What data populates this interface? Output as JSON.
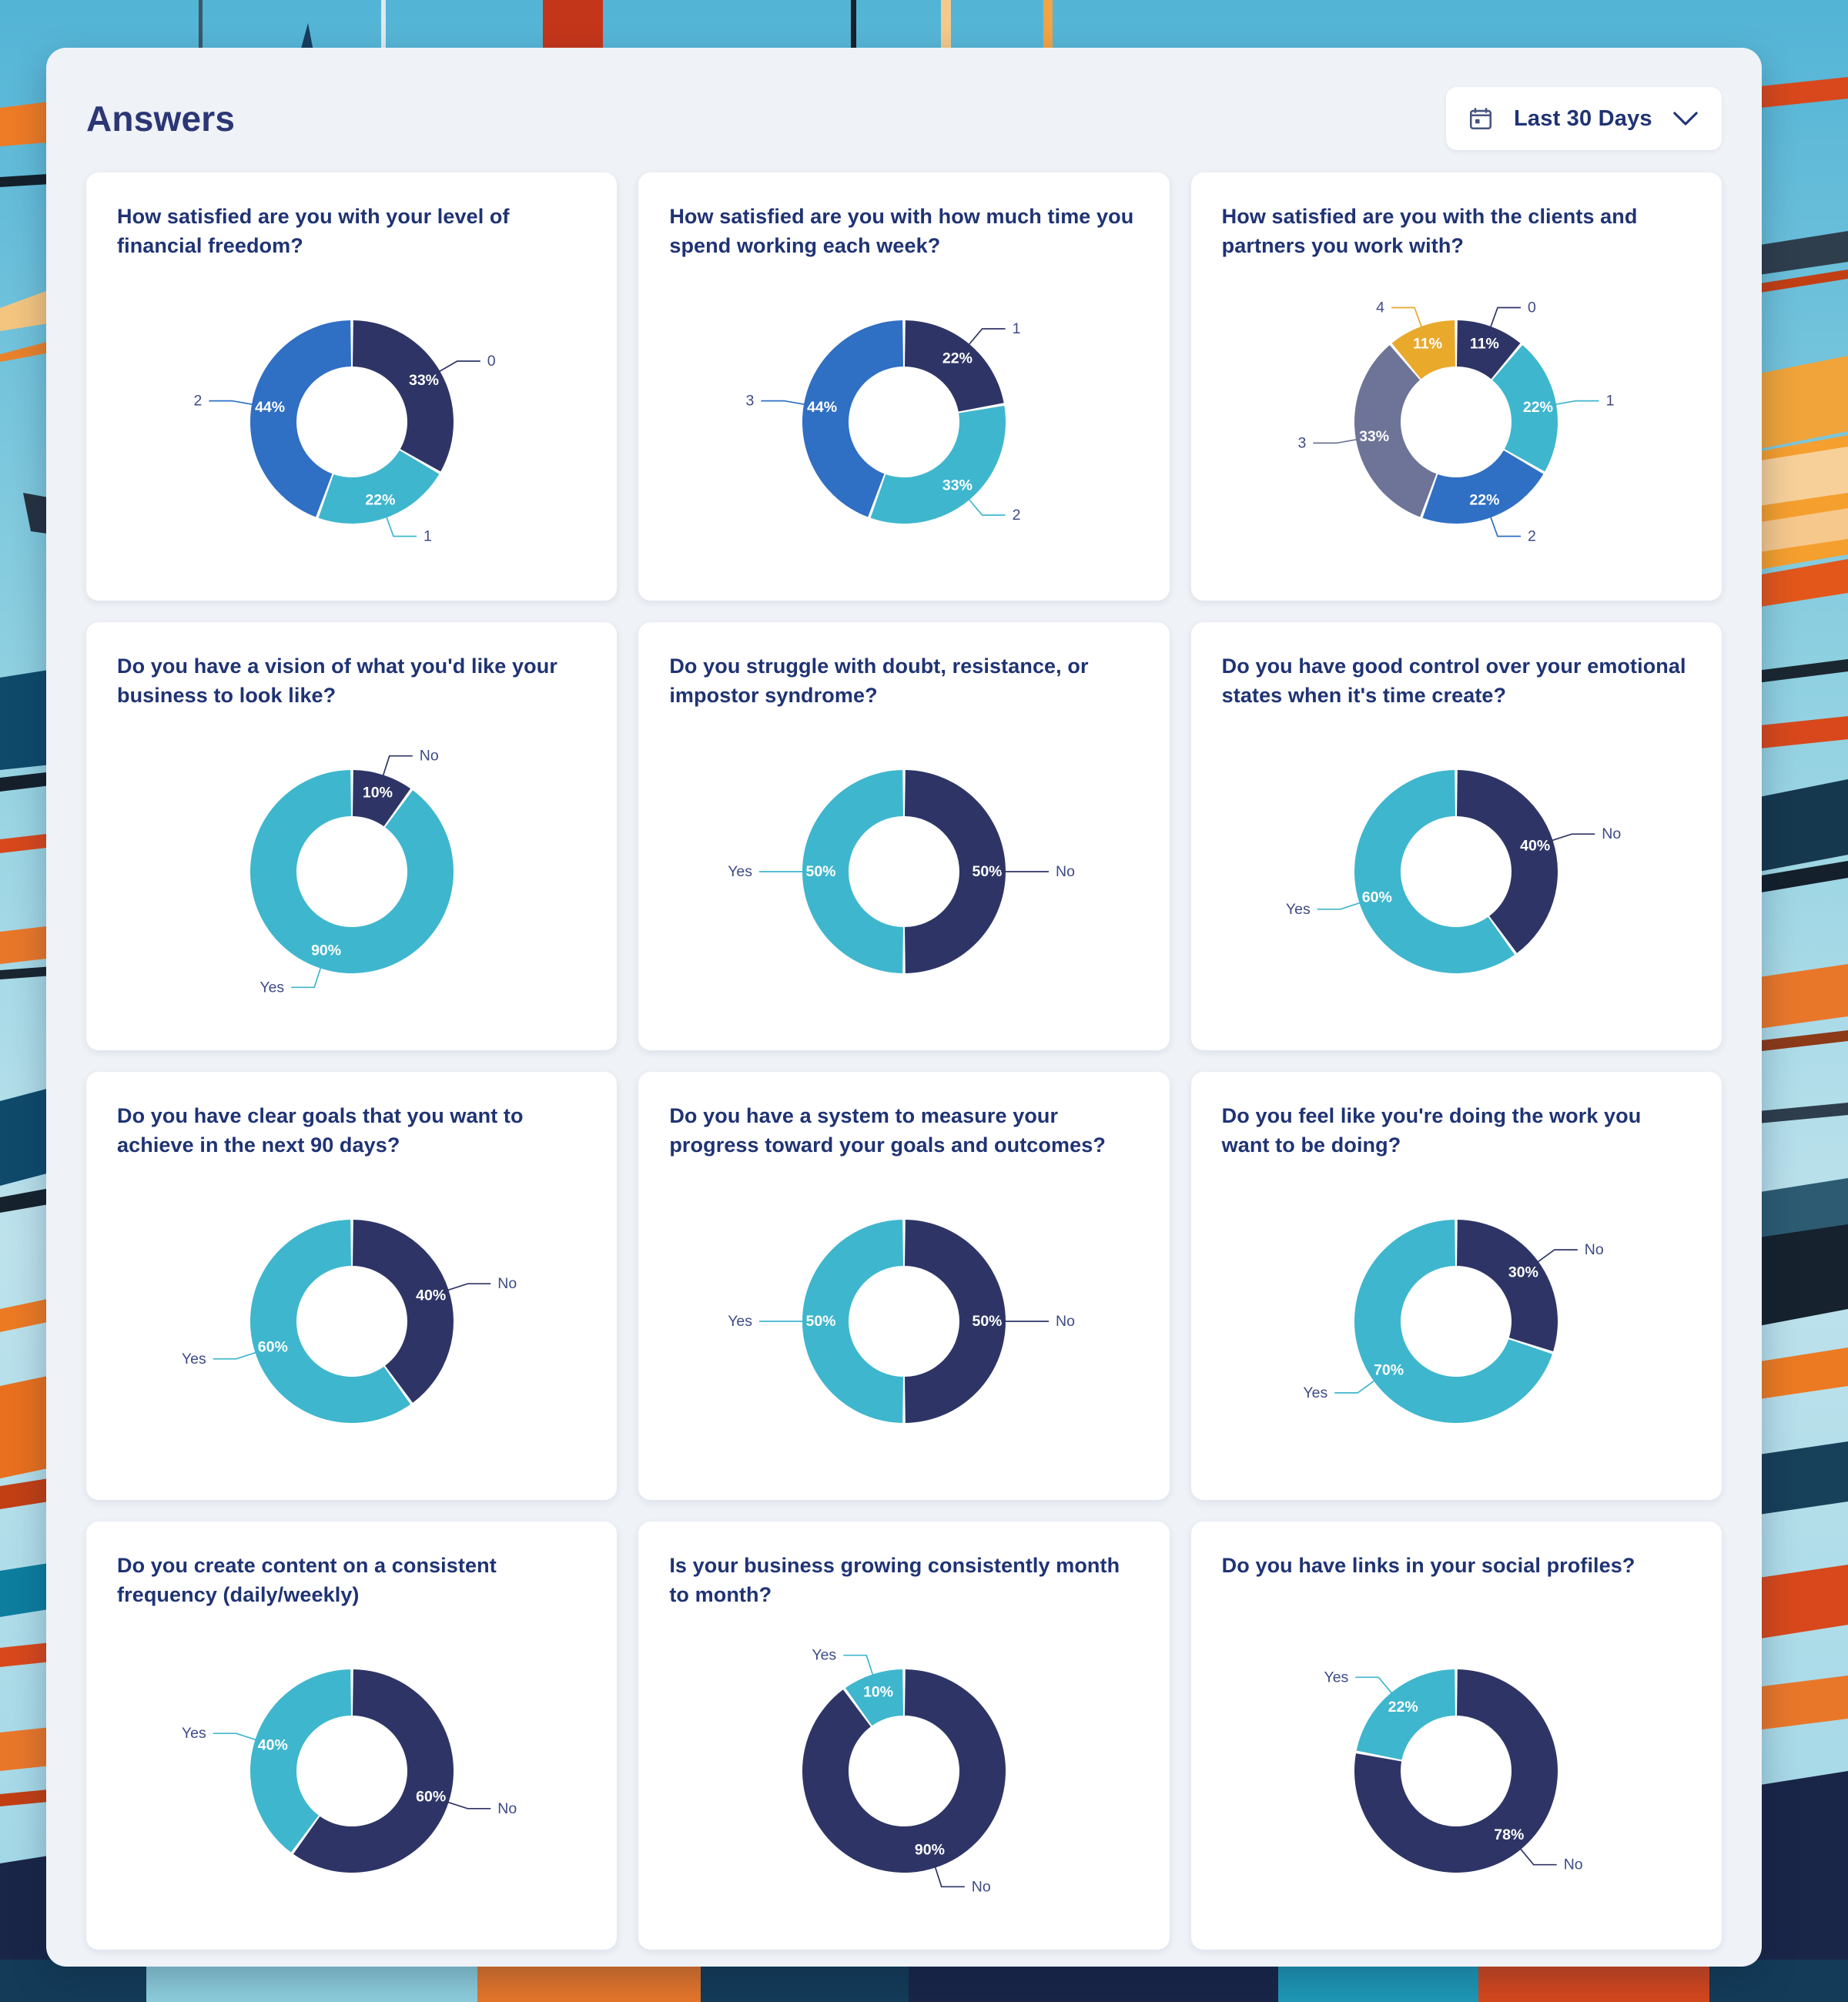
{
  "header": {
    "title": "Answers",
    "date_picker": {
      "label": "Last 30 Days",
      "calendar_icon": "calendar-icon",
      "chevron_icon": "chevron-down-icon"
    }
  },
  "palette": {
    "navy": "#2E3566",
    "cyan": "#3EB6CE",
    "blue": "#2F6FC4",
    "slate": "#6D7497",
    "gold": "#E9A92B",
    "panel_bg": "#EFF2F7",
    "card_bg": "#FFFFFF",
    "title_color": "#1F3374",
    "label_color": "#3E4A86"
  },
  "chart_data": [
    {
      "id": "financial-freedom",
      "type": "pie",
      "title": "How satisfied are you with your level of financial freedom?",
      "categories": [
        "0",
        "1",
        "2"
      ],
      "values": [
        33,
        22,
        44
      ],
      "labels": [
        "33%",
        "22%",
        "44%"
      ],
      "colors": [
        "#2E3566",
        "#3EB6CE",
        "#2F6FC4"
      ],
      "legend": "callout-labels"
    },
    {
      "id": "time-spend-working",
      "type": "pie",
      "title": "How satisfied are you with how much time you spend working each week?",
      "categories": [
        "1",
        "2",
        "3"
      ],
      "values": [
        22,
        33,
        44
      ],
      "labels": [
        "22%",
        "33%",
        "44%"
      ],
      "colors": [
        "#2E3566",
        "#3EB6CE",
        "#2F6FC4"
      ],
      "legend": "callout-labels"
    },
    {
      "id": "clients-and-partners",
      "type": "pie",
      "title": "How satisfied are you with the clients and partners you work with?",
      "categories": [
        "0",
        "1",
        "2",
        "3",
        "4"
      ],
      "values": [
        11,
        22,
        22,
        33,
        11
      ],
      "labels": [
        "11%",
        "22%",
        "22%",
        "33%",
        "11%"
      ],
      "colors": [
        "#2E3566",
        "#3EB6CE",
        "#2F6FC4",
        "#6D7497",
        "#E9A92B"
      ],
      "legend": "callout-labels"
    },
    {
      "id": "business-vision",
      "type": "pie",
      "title": "Do you have a vision of what you'd like your business to look like?",
      "categories": [
        "No",
        "Yes"
      ],
      "values": [
        10,
        90
      ],
      "labels": [
        "10%",
        "90%"
      ],
      "colors": [
        "#2E3566",
        "#3EB6CE"
      ],
      "legend": "callout-labels"
    },
    {
      "id": "doubt-impostor-syndrome",
      "type": "pie",
      "title": "Do you struggle with doubt, resistance, or impostor syndrome?",
      "categories": [
        "No",
        "Yes"
      ],
      "values": [
        50,
        50
      ],
      "labels": [
        "50%",
        "50%"
      ],
      "colors": [
        "#2E3566",
        "#3EB6CE"
      ],
      "legend": "callout-labels"
    },
    {
      "id": "emotional-control",
      "type": "pie",
      "title": "Do you have good control over your emotional states when it's time create?",
      "categories": [
        "No",
        "Yes"
      ],
      "values": [
        40,
        60
      ],
      "labels": [
        "40%",
        "60%"
      ],
      "colors": [
        "#2E3566",
        "#3EB6CE"
      ],
      "legend": "callout-labels"
    },
    {
      "id": "clear-goals-90-days",
      "type": "pie",
      "title": "Do you have clear goals that you want to achieve in the next 90 days?",
      "categories": [
        "No",
        "Yes"
      ],
      "values": [
        40,
        60
      ],
      "labels": [
        "40%",
        "60%"
      ],
      "colors": [
        "#2E3566",
        "#3EB6CE"
      ],
      "legend": "callout-labels"
    },
    {
      "id": "progress-measure-system",
      "type": "pie",
      "title": "Do you have a system to measure your progress toward your goals and outcomes?",
      "categories": [
        "No",
        "Yes"
      ],
      "values": [
        50,
        50
      ],
      "labels": [
        "50%",
        "50%"
      ],
      "colors": [
        "#2E3566",
        "#3EB6CE"
      ],
      "legend": "callout-labels"
    },
    {
      "id": "work-you-want-to-do",
      "type": "pie",
      "title": "Do you feel like you're doing the work you want to be doing?",
      "categories": [
        "No",
        "Yes"
      ],
      "values": [
        30,
        70
      ],
      "labels": [
        "30%",
        "70%"
      ],
      "colors": [
        "#2E3566",
        "#3EB6CE"
      ],
      "legend": "callout-labels"
    },
    {
      "id": "consistent-content",
      "type": "pie",
      "title": "Do you create content on a consistent frequency (daily/weekly)",
      "categories": [
        "No",
        "Yes"
      ],
      "values": [
        60,
        40
      ],
      "labels": [
        "60%",
        "40%"
      ],
      "colors": [
        "#2E3566",
        "#3EB6CE"
      ],
      "legend": "callout-labels"
    },
    {
      "id": "business-growing",
      "type": "pie",
      "title": "Is your business growing consistently month to month?",
      "categories": [
        "No",
        "Yes"
      ],
      "values": [
        90,
        10
      ],
      "labels": [
        "90%",
        "10%"
      ],
      "colors": [
        "#2E3566",
        "#3EB6CE"
      ],
      "legend": "callout-labels"
    },
    {
      "id": "social-profile-links",
      "type": "pie",
      "title": "Do you have links in your social profiles?",
      "categories": [
        "No",
        "Yes"
      ],
      "values": [
        78,
        22
      ],
      "labels": [
        "78%",
        "22%"
      ],
      "colors": [
        "#2E3566",
        "#3EB6CE"
      ],
      "legend": "callout-labels"
    }
  ]
}
